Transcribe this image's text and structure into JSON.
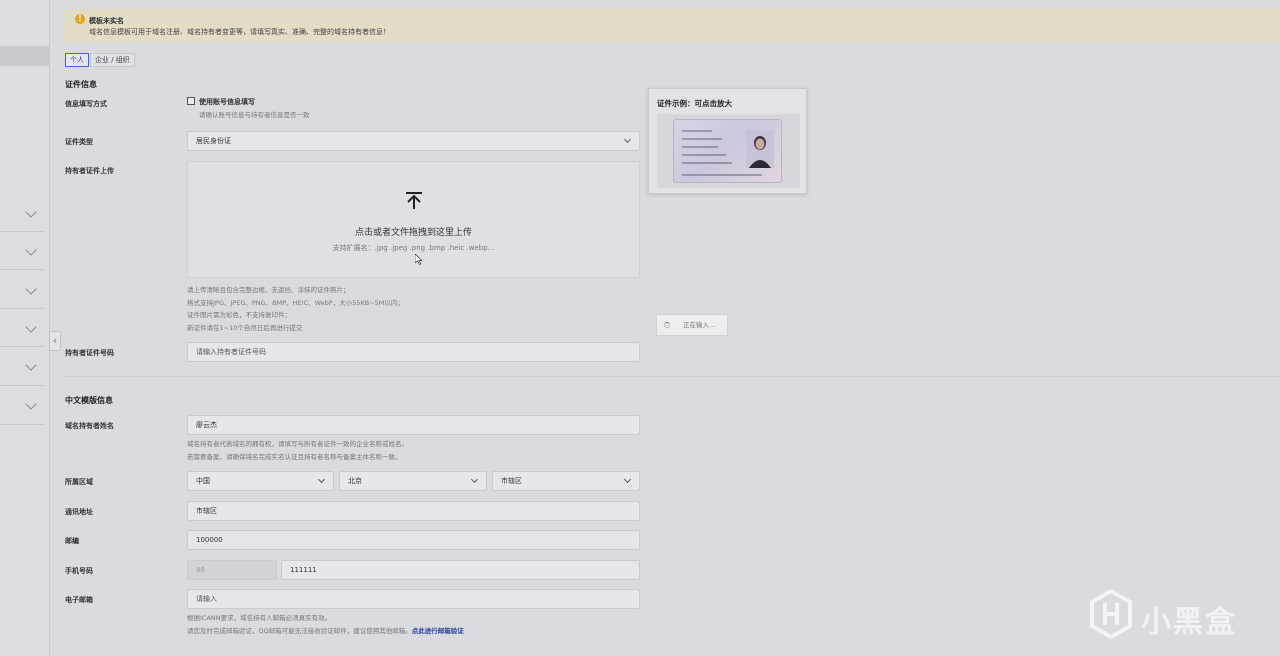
{
  "banner": {
    "title": "模板未实名",
    "text": "域名信息模板可用于域名注册、域名持有者变更等，请填写真实、准确、完整的域名持有者信息！"
  },
  "tabs": [
    {
      "label": "个人",
      "active": true
    },
    {
      "label": "企业 / 组织",
      "active": false
    }
  ],
  "cert_section": {
    "title": "证件信息",
    "fill_mode_label": "信息填写方式",
    "use_account_label": "使用账号信息填写",
    "use_account_hint": "请确认账号信息与持有者信息是否一致",
    "cert_type_label": "证件类型",
    "cert_type_value": "居民身份证",
    "upload_label": "持有者证件上传",
    "upload_title": "点击或者文件拖拽到这里上传",
    "upload_formats": "支持扩展名：.jpg .jpeg .png .bmp .heic .webp...",
    "upload_hints": [
      "请上传清晰且包含完整边框、无遮挡、涂抹的证件照片；",
      "格式支持JPG、JPEG、PNG、BMP、HEIC、WebP，大小55KB~5M以内；",
      "证件图片需为彩色，不支持复印件；",
      "新证件请在1~10个自然日后再进行提交"
    ],
    "cert_number_label": "持有者证件号码",
    "cert_number_placeholder": "请输入持有者证件号码"
  },
  "example": {
    "title": "证件示例：可点击放大"
  },
  "loading_text": "正在输入...",
  "cn_section": {
    "title": "中文模版信息",
    "owner_name_label": "域名持有者姓名",
    "owner_name_value": "廖云杰",
    "owner_hints": [
      "域名持有者代表域名的拥有权，请填写与所有者证件一致的企业名称或姓名。",
      "若需要备案，请确保域名完成实名认证且持有者名称与备案主体名称一致。"
    ],
    "region_label": "所属区域",
    "country": "中国",
    "province": "北京",
    "city": "市辖区",
    "address_label": "通讯地址",
    "address_value": "市辖区",
    "postcode_label": "邮编",
    "postcode_value": "100000",
    "phone_label": "手机号码",
    "phone_prefix": "86",
    "phone_value": "111111",
    "email_label": "电子邮箱",
    "email_placeholder": "请输入",
    "email_hint_1": "根据ICANN要求，域名持有人邮箱必须真实有效。",
    "email_hint_2": "请您及时完成邮箱验证，QQ邮箱可能无法接收验证邮件，建议使用其他邮箱。",
    "email_verify_link": "点此进行邮箱验证"
  },
  "watermark": "小黑盒",
  "colors": {
    "accent": "#2a3ea0",
    "warning": "#e2a322",
    "banner_bg": "#e2ddc6"
  }
}
